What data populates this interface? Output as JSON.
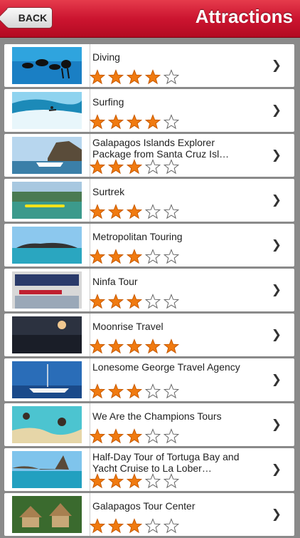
{
  "nav": {
    "back_label": "BACK",
    "title": "Attractions"
  },
  "items": [
    {
      "title": "Diving",
      "rating": 4
    },
    {
      "title": "Surfing",
      "rating": 4
    },
    {
      "title": "Galapagos Islands Explorer Package from Santa Cruz Isl…",
      "rating": 3
    },
    {
      "title": "Surtrek",
      "rating": 3
    },
    {
      "title": "Metropolitan Touring",
      "rating": 3
    },
    {
      "title": "Ninfa Tour",
      "rating": 3
    },
    {
      "title": "Moonrise Travel",
      "rating": 5
    },
    {
      "title": "Lonesome George Travel Agency",
      "rating": 3
    },
    {
      "title": "We Are the Champions Tours",
      "rating": 3
    },
    {
      "title": "Half-Day Tour of Tortuga Bay and Yacht Cruise to La Lober…",
      "rating": 3
    },
    {
      "title": "Galapagos Tour Center",
      "rating": 3
    }
  ],
  "icons": {
    "chevron": "chevron-right-icon",
    "star_filled": "star-filled-icon",
    "star_empty": "star-outline-icon",
    "back": "back-arrow-icon"
  },
  "colors": {
    "nav_red": "#cc1530",
    "star_orange": "#f07a10"
  }
}
